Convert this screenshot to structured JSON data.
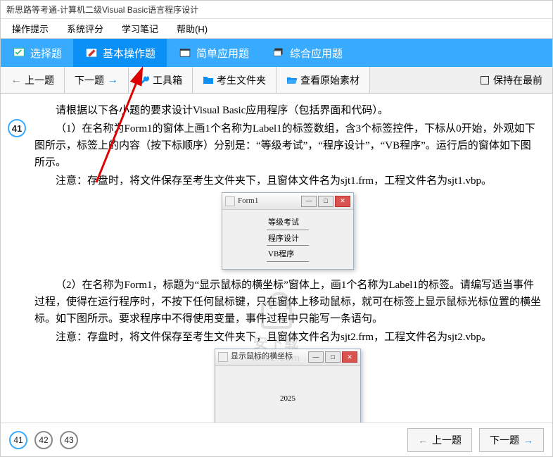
{
  "window_title": "新思路等考通-计算机二级Visual  Basic语言程序设计",
  "menu": {
    "m1": "操作提示",
    "m2": "系统评分",
    "m3": "学习笔记",
    "m4": "帮助(H)"
  },
  "tabs": {
    "t1": "选择题",
    "t2": "基本操作题",
    "t3": "简单应用题",
    "t4": "综合应用题"
  },
  "toolbar": {
    "prev": "上一题",
    "next": "下一题",
    "toolbox": "工具箱",
    "folder": "考生文件夹",
    "view_src": "查看原始素材",
    "keep_top": "保持在最前"
  },
  "question": {
    "number": "41",
    "intro": "请根据以下各小题的要求设计Visual Basic应用程序（包括界面和代码）。",
    "p1": "（1）在名称为Form1的窗体上画1个名称为Label1的标签数组，含3个标签控件，下标从0开始，外观如下图所示，标签上的内容（按下标顺序）分别是：“等级考试”，“程序设计”，“VB程序”。运行后的窗体如下图所示。",
    "p1_note": "注意：存盘时，将文件保存至考生文件夹下，且窗体文件名为sjt1.frm，工程文件名为sjt1.vbp。",
    "vb1": {
      "title": "Form1",
      "l1": "等级考试",
      "l2": "程序设计",
      "l3": "VB程序"
    },
    "p2": "（2）在名称为Form1，标题为“显示鼠标的横坐标”窗体上，画1个名称为Label1的标签。请编写适当事件过程，使得在运行程序时，不按下任何鼠标键，只在窗体上移动鼠标，就可在标签上显示鼠标光标位置的横坐标。如下图所示。要求程序中不得使用变量，事件过程中只能写一条语句。",
    "p2_note": "注意：存盘时，将文件保存至考生文件夹下，且窗体文件名为sjt2.frm，工程文件名为sjt2.vbp。",
    "vb2": {
      "title": "显示鼠标的横坐标",
      "value": "2025"
    }
  },
  "watermark": {
    "t1": "安下载",
    "t2": "anxz.com"
  },
  "footer": {
    "p1": "41",
    "p2": "42",
    "p3": "43",
    "prev": "上一题",
    "next": "下一题"
  }
}
